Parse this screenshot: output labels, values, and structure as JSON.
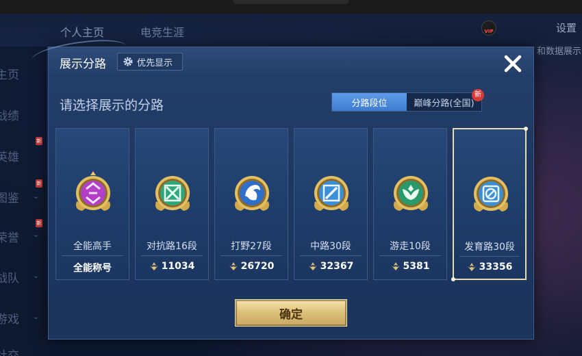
{
  "background": {
    "nav_tabs": [
      "个人主页",
      "电竞生涯"
    ],
    "settings_label": "设置",
    "vip_label": "VIP",
    "side_items": [
      "主页",
      "战绩",
      "英雄",
      "图鉴",
      "荣誉",
      "战队",
      "游戏",
      "社交"
    ],
    "side_new_label": "新",
    "right_strip_text": "和数据展示"
  },
  "dialog": {
    "title": "展示分路",
    "priority_button_label": "优先显示",
    "subtitle": "请选择展示的分路",
    "seg_tabs": [
      {
        "label": "分路段位",
        "active": true
      },
      {
        "label": "巅峰分路(全国)",
        "active": false,
        "badge": "新"
      }
    ],
    "cards": [
      {
        "name": "all-round",
        "label": "全能高手",
        "bottom_text": "全能称号",
        "score": null,
        "emblem_color": "#b23fc7",
        "emblem_icon": "square-swirl",
        "selected": false
      },
      {
        "name": "clash-lane",
        "label": "对抗路16段",
        "bottom_text": null,
        "score": "11034",
        "emblem_color": "#2ea87a",
        "emblem_icon": "crossed-swords",
        "selected": false
      },
      {
        "name": "jungle",
        "label": "打野27段",
        "bottom_text": null,
        "score": "26720",
        "emblem_color": "#2f6ec9",
        "emblem_icon": "dragon",
        "selected": false
      },
      {
        "name": "mid-lane",
        "label": "中路30段",
        "bottom_text": null,
        "score": "32367",
        "emblem_color": "#3a8fd8",
        "emblem_icon": "staff",
        "selected": false
      },
      {
        "name": "roam",
        "label": "游走10段",
        "bottom_text": null,
        "score": "5381",
        "emblem_color": "#2a9a6a",
        "emblem_icon": "wings",
        "selected": false
      },
      {
        "name": "farm-lane",
        "label": "发育路30段",
        "bottom_text": null,
        "score": "33356",
        "emblem_color": "#3d8fd4",
        "emblem_icon": "bow",
        "selected": true
      }
    ],
    "confirm_label": "确定"
  },
  "colors": {
    "accent_blue": "#4a8ae0",
    "gold": "#dcbf78",
    "panel": "#1e3862"
  }
}
